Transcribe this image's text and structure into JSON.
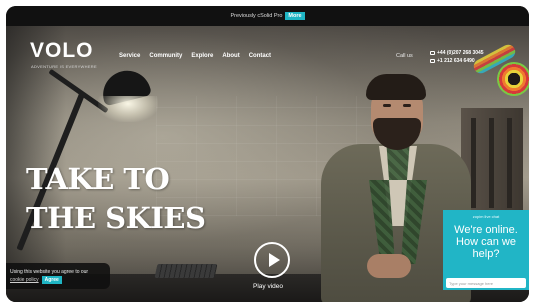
{
  "promo": {
    "text": "Previously cSolid Pro",
    "more_label": "More"
  },
  "brand": {
    "logo": "VOLO",
    "tagline": "ADVENTURE IS EVERYWHERE"
  },
  "nav": {
    "items": [
      "Service",
      "Community",
      "Explore",
      "About",
      "Contact"
    ]
  },
  "contact": {
    "call_label": "Call us",
    "phone_uk": "+44 (0)207 268 3045",
    "phone_us": "+1 212 634 6490"
  },
  "hero": {
    "headline_line1": "TAKE TO",
    "headline_line2": "THE SKIES",
    "play_label": "Play video"
  },
  "cookie": {
    "text": "Using this website you agree to our",
    "policy_link": "cookie policy",
    "agree_label": "Agree"
  },
  "chat": {
    "agent_label": "zopim live chat",
    "message": "We're online. How can we help?",
    "input_placeholder": "Type your message here"
  },
  "colors": {
    "accent": "#21b5c6",
    "header_bg": "#111111"
  }
}
